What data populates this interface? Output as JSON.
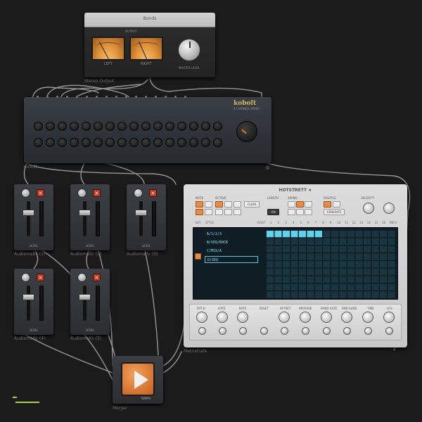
{
  "devices": {
    "stereo_output": {
      "title": "Bonds",
      "label": "Stereo Output",
      "meter_caption": "OUTPUT",
      "left_meter": "LEFT",
      "right_meter": "RIGHT",
      "knob_label": "MASTER LEVEL"
    },
    "kobolt": {
      "label": "Kobolt",
      "brand": "kobolt",
      "subtitle": "8 CHANNEL MIXER"
    },
    "channels": [
      {
        "label": "Audiomatic (1)",
        "footer": "LEVEL"
      },
      {
        "label": "Audiomatic (2)",
        "footer": "LEVEL"
      },
      {
        "label": "Audiomatic (3)",
        "footer": "LEVEL"
      },
      {
        "label": "Audiomatic (4)",
        "footer": "LEVEL"
      },
      {
        "label": "Audiomatic (5)",
        "footer": "LEVEL"
      }
    ],
    "matrix": {
      "label": "Matrixtrate",
      "title": "HOTSTRETT ★",
      "groups": {
        "note": "NOTE",
        "octave": "OCTAVE",
        "length": "LENGTH",
        "swing": "SWING",
        "shuffle": "SHUFFLE",
        "velocity": "VELOCITY"
      },
      "buttons": {
        "clear": "CLEAR",
        "on": "ON",
        "generate": "GENERATE"
      },
      "step_row_labels": {
        "left": "KEY",
        "mid": "STYLE",
        "right": "ROOT",
        "end": "INFO"
      },
      "step_numbers": [
        "1",
        "2",
        "3",
        "4",
        "5",
        "6",
        "7",
        "8",
        "9",
        "10",
        "11",
        "12",
        "13",
        "14",
        "15",
        "16"
      ],
      "patterns": [
        "A/1/2/3",
        "B/SEQ/ROCK",
        "C/MIX/A",
        "D/SEQ"
      ],
      "lower_labels": [
        "PITCH",
        "GATE",
        "RATE",
        "RESET",
        "OFFSET",
        "REVERSE",
        "RAND GATE",
        "RND SLIDE",
        "TIME",
        "LFO"
      ]
    },
    "merger": {
      "label": "Merger",
      "mini_label": "TEMPO"
    }
  },
  "colors": {
    "accent": "#e88b45",
    "screen_bg": "#0f1d24",
    "cable": "#9a9a9a",
    "led": "#5ed3ee",
    "load": "#a7d52d"
  },
  "icons": {
    "play": "play-icon",
    "close": "close-icon",
    "power": "power-icon"
  }
}
